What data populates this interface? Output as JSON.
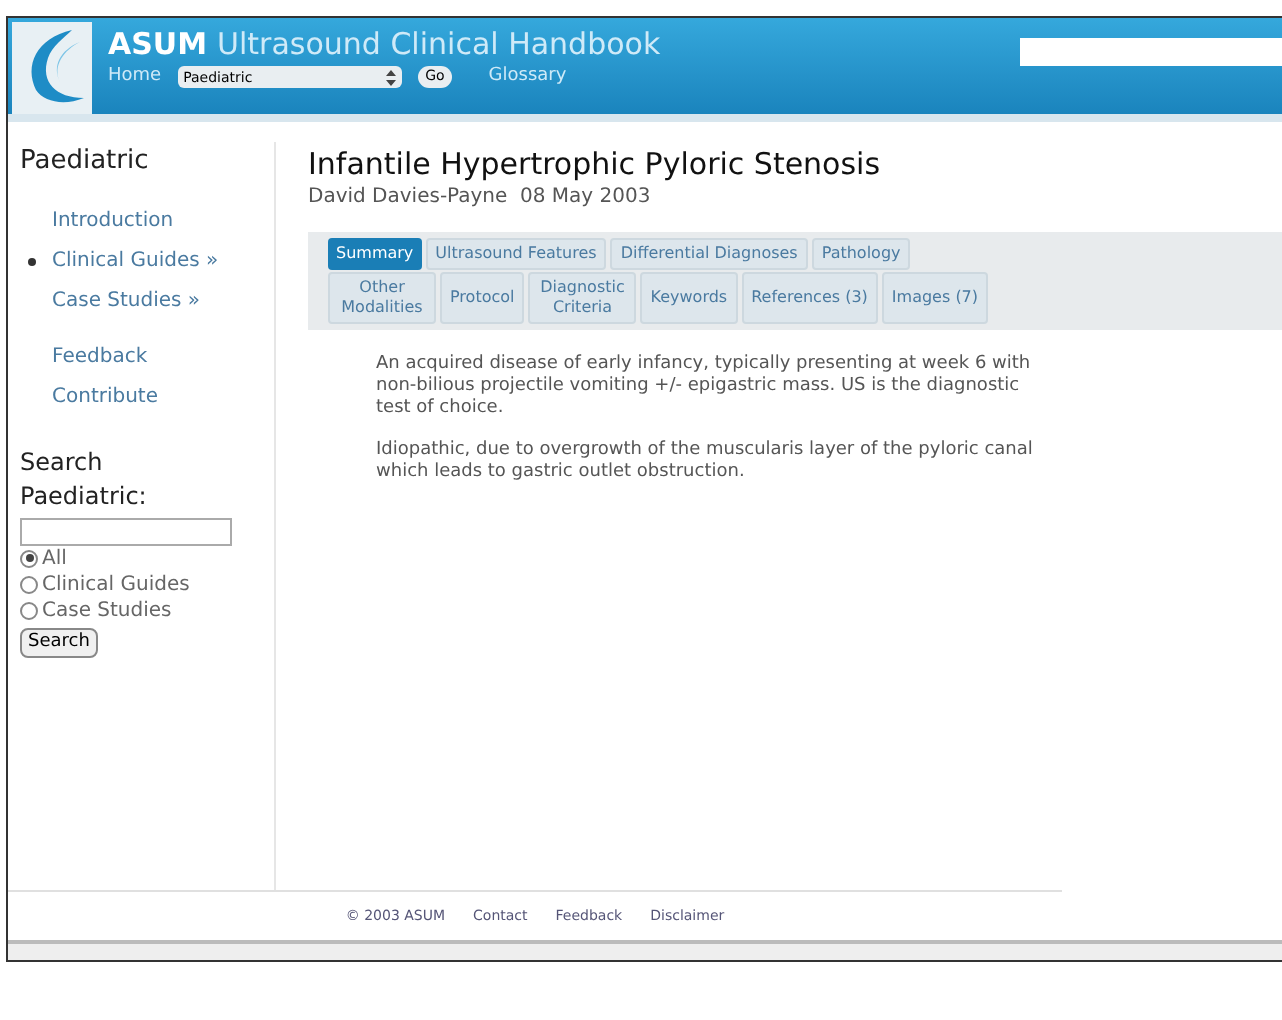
{
  "header": {
    "brand": "ASUM",
    "title": "Ultrasound Clinical Handbook",
    "nav": {
      "home": "Home",
      "select_value": "Paediatric",
      "go": "Go",
      "glossary": "Glossary"
    }
  },
  "sidebar": {
    "heading": "Paediatric",
    "items": [
      {
        "label": "Introduction",
        "selected": false
      },
      {
        "label": "Clinical Guides »",
        "selected": true
      },
      {
        "label": "Case Studies »",
        "selected": false
      }
    ],
    "links": [
      "Feedback",
      "Contribute"
    ],
    "search": {
      "heading": "Search Paediatric:",
      "options": [
        {
          "label": "All",
          "selected": true
        },
        {
          "label": "Clinical Guides",
          "selected": false
        },
        {
          "label": "Case Studies",
          "selected": false
        }
      ],
      "button": "Search"
    }
  },
  "article": {
    "title": "Infantile Hypertrophic Pyloric Stenosis",
    "byline": "David Davies-Payne  08 May 2003",
    "tab_rows": [
      [
        {
          "label": "Summary",
          "selected": true
        },
        {
          "label": "Ultrasound Features",
          "selected": false
        },
        {
          "label": "Differential Diagnoses",
          "selected": false
        },
        {
          "label": "Pathology",
          "selected": false
        }
      ],
      [
        {
          "label": "Other Modalities",
          "selected": false
        },
        {
          "label": "Protocol",
          "selected": false
        },
        {
          "label": "Diagnostic Criteria",
          "selected": false
        },
        {
          "label": "Keywords",
          "selected": false
        },
        {
          "label": "References (3)",
          "selected": false
        },
        {
          "label": "Images (7)",
          "selected": false
        }
      ]
    ],
    "paragraphs": [
      [
        "An acquired disease of early infancy, typically presenting at week 6 with",
        "non-bilious projectile vomiting +/- epigastric mass. US is the diagnostic",
        "test of choice."
      ],
      [
        "Idiopathic, due to overgrowth of the muscularis layer of the pyloric canal",
        "which leads to gastric outlet obstruction."
      ]
    ]
  },
  "footer": {
    "links": [
      "© 2003 ASUM",
      "Contact",
      "Feedback",
      "Disclaimer"
    ]
  }
}
